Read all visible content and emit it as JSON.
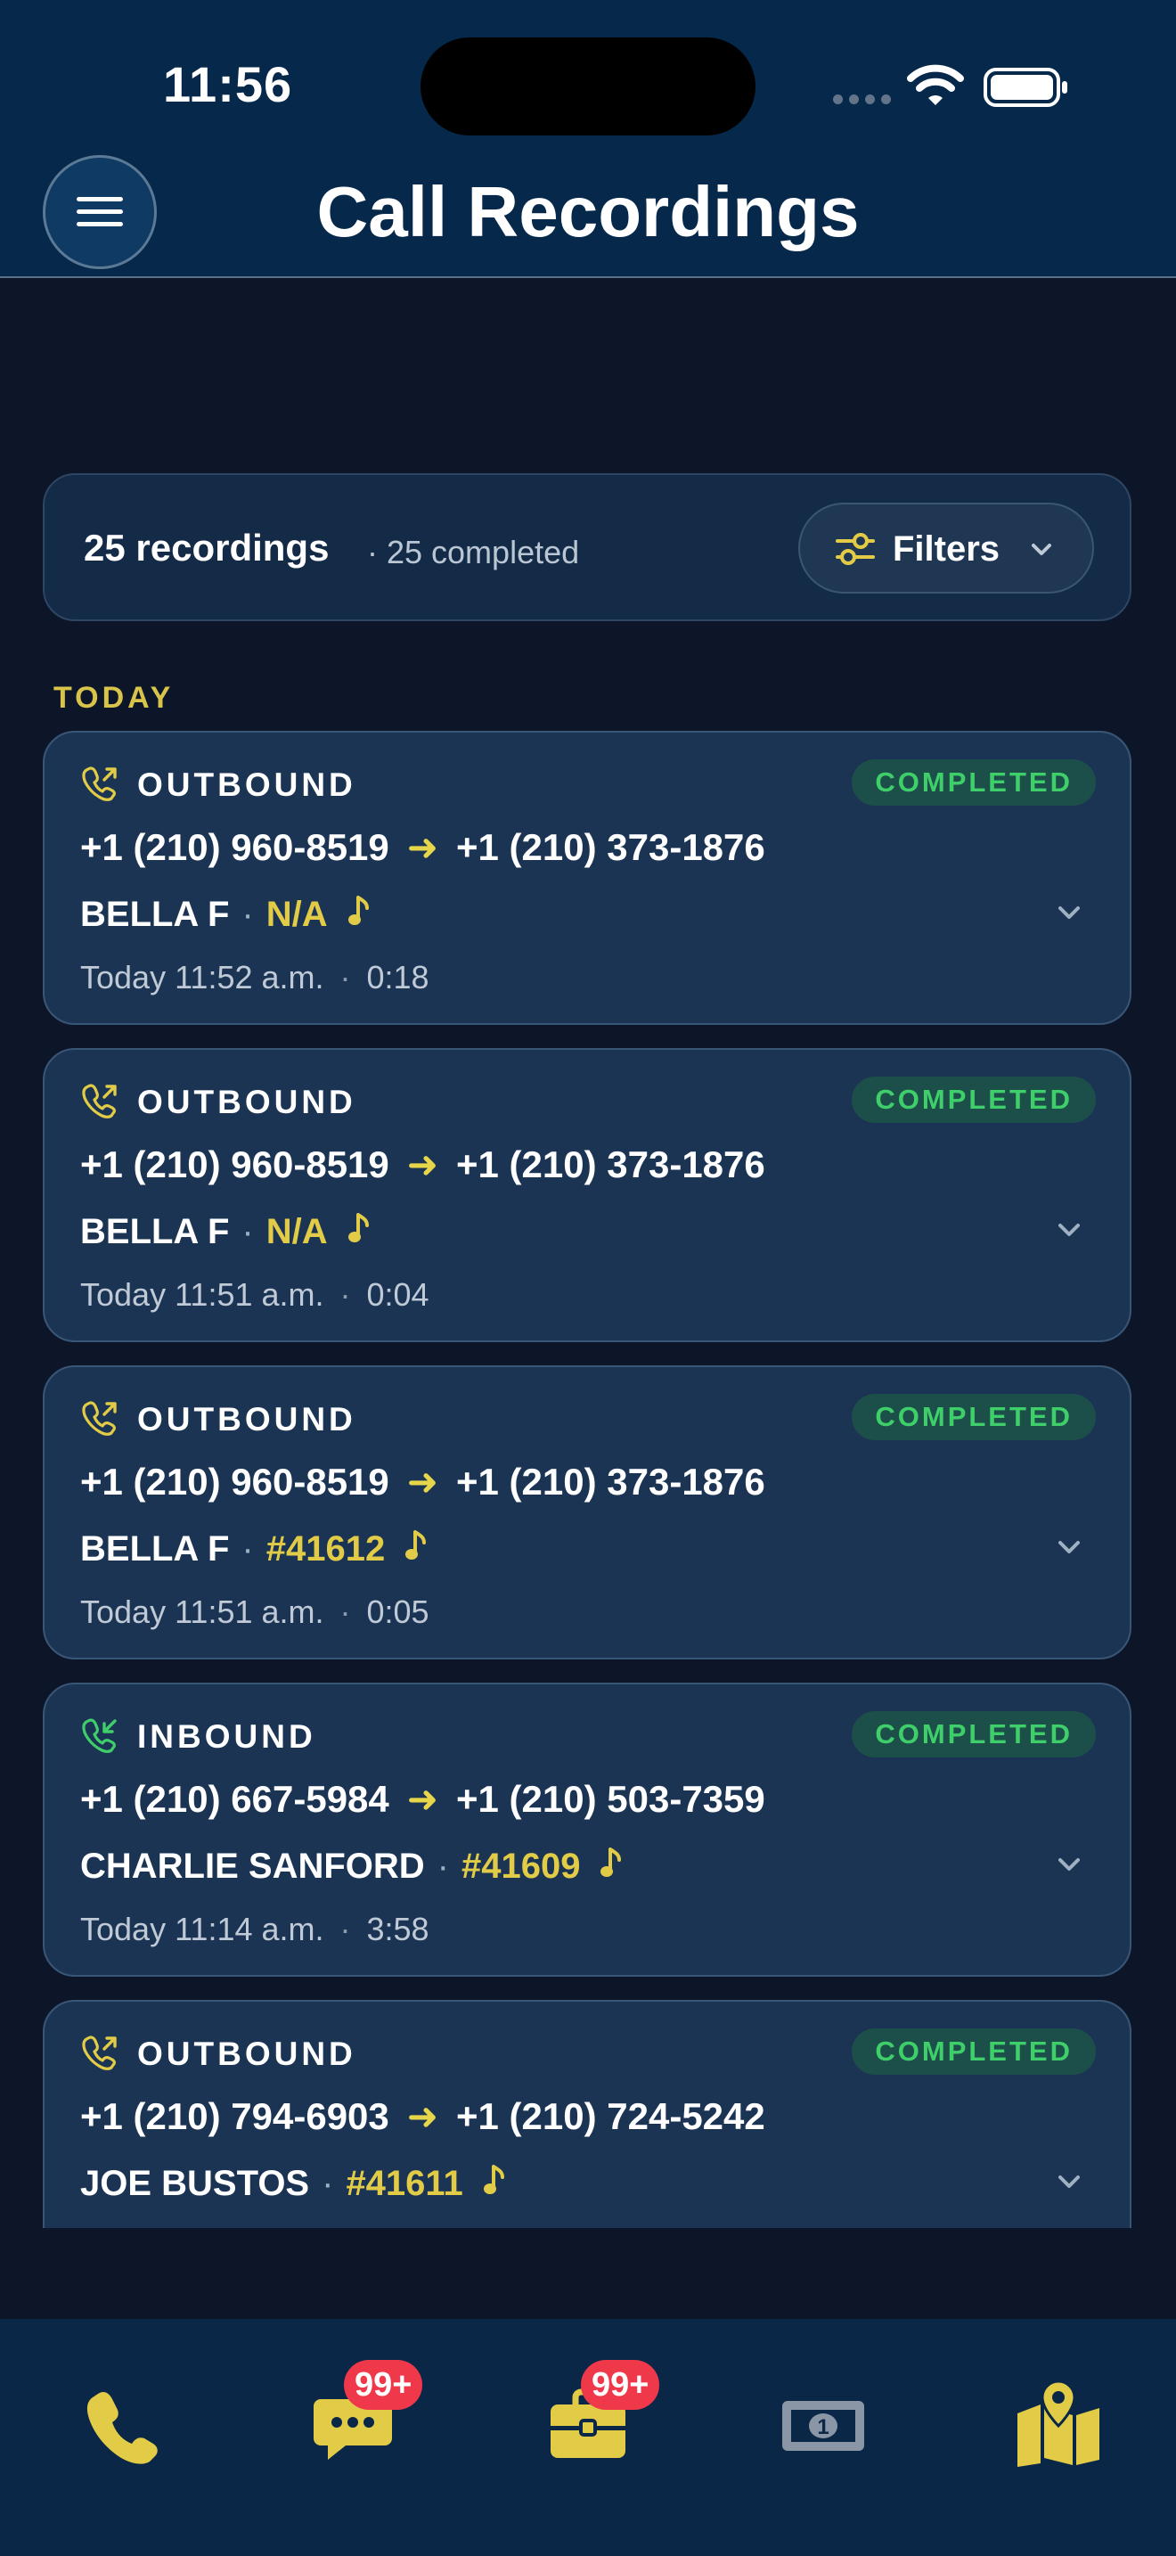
{
  "status_bar": {
    "time": "11:56"
  },
  "header": {
    "title": "Call Recordings"
  },
  "summary": {
    "count_label": "25 recordings",
    "completed_label": "· 25 completed",
    "filters_label": "Filters"
  },
  "section": {
    "label": "TODAY"
  },
  "recordings": [
    {
      "direction": "OUTBOUND",
      "status": "COMPLETED",
      "from": "+1 (210) 960-8519",
      "to": "+1 (210) 373-1876",
      "contact": "BELLA F",
      "ref": "N/A",
      "time": "Today 11:52 a.m.",
      "duration": "0:18"
    },
    {
      "direction": "OUTBOUND",
      "status": "COMPLETED",
      "from": "+1 (210) 960-8519",
      "to": "+1 (210) 373-1876",
      "contact": "BELLA F",
      "ref": "N/A",
      "time": "Today 11:51 a.m.",
      "duration": "0:04"
    },
    {
      "direction": "OUTBOUND",
      "status": "COMPLETED",
      "from": "+1 (210) 960-8519",
      "to": "+1 (210) 373-1876",
      "contact": "BELLA F",
      "ref": "#41612",
      "time": "Today 11:51 a.m.",
      "duration": "0:05"
    },
    {
      "direction": "INBOUND",
      "status": "COMPLETED",
      "from": "+1 (210) 667-5984",
      "to": "+1 (210) 503-7359",
      "contact": "CHARLIE SANFORD",
      "ref": "#41609",
      "time": "Today 11:14 a.m.",
      "duration": "3:58"
    },
    {
      "direction": "OUTBOUND",
      "status": "COMPLETED",
      "from": "+1 (210) 794-6903",
      "to": "+1 (210) 724-5242",
      "contact": "JOE BUSTOS",
      "ref": "#41611",
      "time": "",
      "duration": ""
    }
  ],
  "tabbar": {
    "messages_badge": "99+",
    "jobs_badge": "99+",
    "icons": [
      "phone-icon",
      "chat-icon",
      "briefcase-icon",
      "money-icon",
      "map-icon"
    ]
  },
  "colors": {
    "header_bg": "#06284a",
    "page_bg": "#0c1628",
    "card_bg": "#1b3454",
    "accent_yellow": "#e2cc47",
    "completed_green": "#3ecf6a",
    "inbound_green": "#3ecf6a",
    "badge_red": "#f0384b"
  }
}
